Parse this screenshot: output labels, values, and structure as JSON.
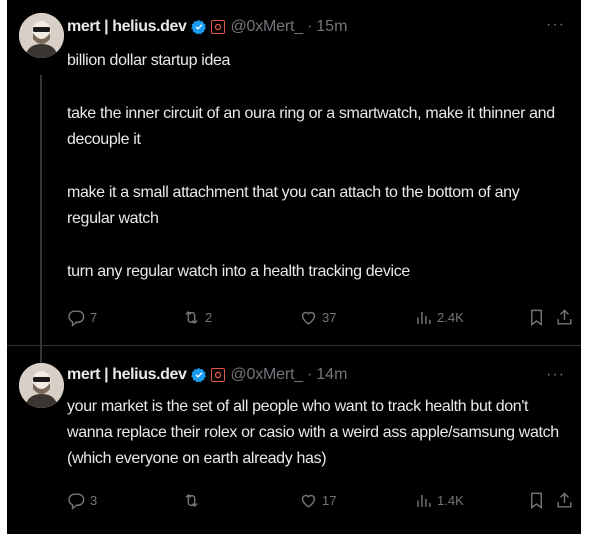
{
  "tweets": [
    {
      "author": {
        "name": "mert | helius.dev",
        "handle": "@0xMert_"
      },
      "time": "15m",
      "paragraphs": [
        "billion dollar startup idea",
        "take the inner circuit of an oura ring or a smartwatch, make it thinner and decouple it",
        "make it a small attachment that you can attach to the bottom of any regular watch",
        "turn any regular watch into a health tracking device"
      ],
      "stats": {
        "replies": "7",
        "reposts": "2",
        "likes": "37",
        "views": "2.4K"
      }
    },
    {
      "author": {
        "name": "mert | helius.dev",
        "handle": "@0xMert_"
      },
      "time": "14m",
      "paragraphs": [
        "your market is the set of all people who want to track health but don't wanna replace their rolex or casio with a weird ass apple/samsung watch (which everyone on earth already has)"
      ],
      "stats": {
        "replies": "3",
        "reposts": "",
        "likes": "17",
        "views": "1.4K"
      }
    }
  ],
  "ui": {
    "separator_dot": "·",
    "more_glyph": "···"
  },
  "colors": {
    "background": "#000000",
    "text": "#e7e9ea",
    "muted": "#71767b",
    "verified": "#1d9bf0",
    "affiliate": "#e05a4a"
  }
}
